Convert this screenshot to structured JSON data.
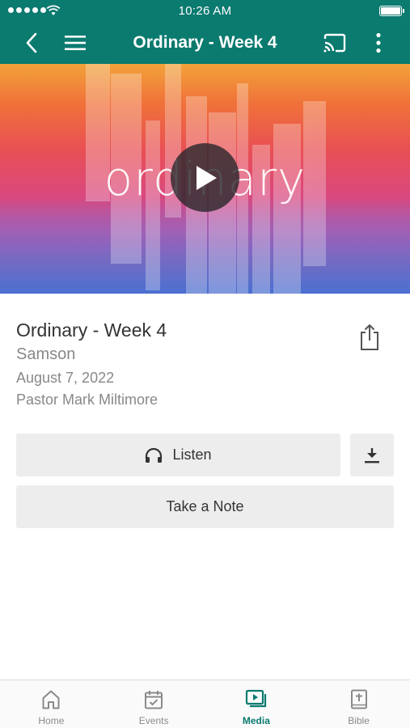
{
  "status_bar": {
    "time": "10:26 AM"
  },
  "nav": {
    "title": "Ordinary - Week 4"
  },
  "hero": {
    "word": "ordinary"
  },
  "sermon": {
    "title": "Ordinary - Week 4",
    "series": "Samson",
    "date": "August 7, 2022",
    "speaker": "Pastor Mark Miltimore"
  },
  "actions": {
    "listen_label": "Listen",
    "note_label": "Take a Note"
  },
  "tabs": [
    {
      "label": "Home",
      "icon": "home-icon"
    },
    {
      "label": "Events",
      "icon": "calendar-icon"
    },
    {
      "label": "Media",
      "icon": "media-icon",
      "active": true
    },
    {
      "label": "Bible",
      "icon": "bible-icon"
    }
  ],
  "colors": {
    "brand": "#0b7a6f",
    "button_bg": "#ededee"
  }
}
